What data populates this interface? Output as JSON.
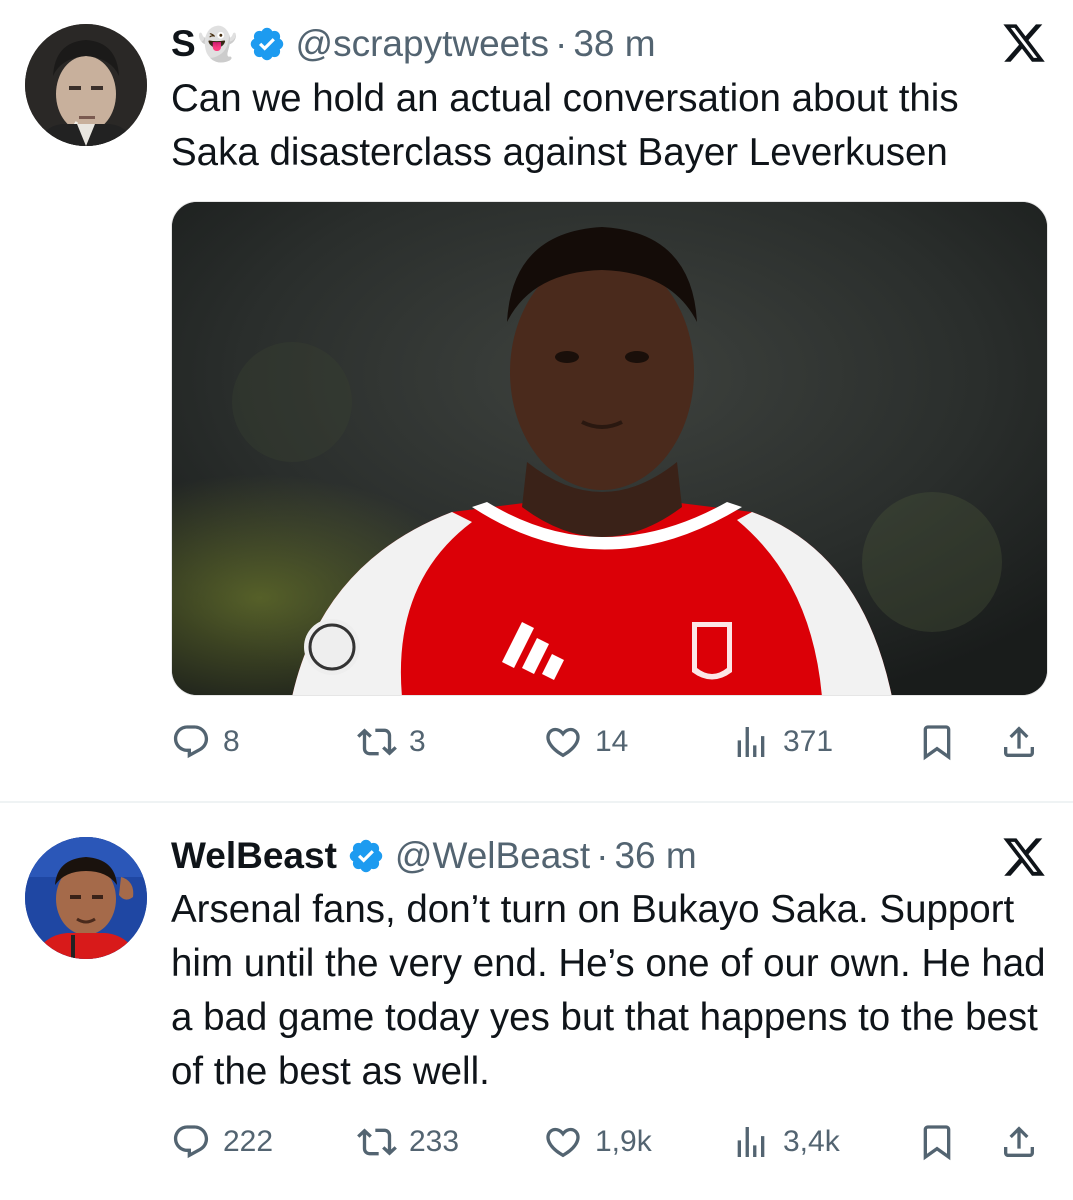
{
  "tweets": [
    {
      "name": "S",
      "name_emoji": "👻",
      "handle": "@scrapytweets",
      "separator": "·",
      "time": "38 m",
      "text": "Can we hold an actual conversation about this Saka disasterclass against Bayer Leverkusen",
      "has_media": true,
      "stats": {
        "replies": "8",
        "retweets": "3",
        "likes": "14",
        "views": "371"
      }
    },
    {
      "name": "WelBeast",
      "handle": "@WelBeast",
      "separator": "·",
      "time": "36 m",
      "text": "Arsenal fans, don’t turn on Bukayo Saka. Support him until the very end. He’s one of our own. He had a bad game today yes but that happens to the best of the best as well.",
      "has_media": false,
      "stats": {
        "replies": "222",
        "retweets": "233",
        "likes": "1,9k",
        "views": "3,4k"
      }
    }
  ],
  "colors": {
    "text": "#0f1419",
    "secondary": "#536471",
    "verified": "#1d9bf0",
    "divider": "#eff3f4",
    "kit_red": "#db0007"
  },
  "icons": [
    "reply-icon",
    "retweet-icon",
    "like-icon",
    "views-icon",
    "bookmark-icon",
    "share-icon",
    "verified-badge-icon",
    "x-logo-icon"
  ]
}
